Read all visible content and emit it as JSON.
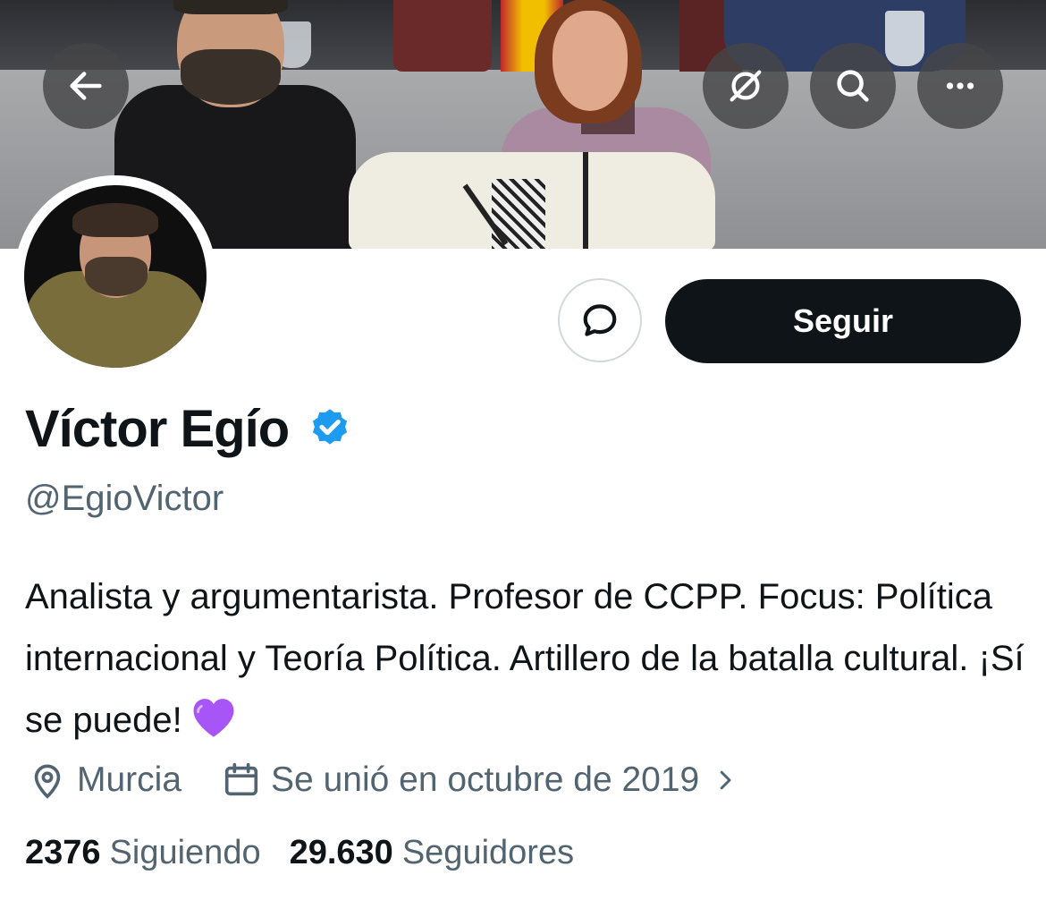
{
  "banner": {
    "back_icon": "arrow-left-icon",
    "top_actions": [
      "translate-off-icon",
      "search-icon",
      "more-icon"
    ]
  },
  "profile": {
    "name": "Víctor Egío",
    "handle": "@EgioVictor",
    "verified": true,
    "verified_color": "#1d9bf0",
    "bio": "Analista y argumentarista. Profesor de CCPP. Focus: Política internacional y Teoría Política. Artillero de la batalla cultural. ¡Sí se puede!",
    "bio_emoji": "purple-heart",
    "location": "Murcia",
    "joined": "Se unió en octubre de 2019"
  },
  "actions": {
    "follow_label": "Seguir",
    "message_icon": "message-bubble-icon"
  },
  "stats": {
    "following_count": "2376",
    "following_label": "Siguiendo",
    "followers_count": "29.630",
    "followers_label": "Seguidores"
  },
  "colors": {
    "text_primary": "#0f1419",
    "text_secondary": "#536471",
    "follow_bg": "#0f1419",
    "border": "#cfd9de",
    "heart": "#a855f7"
  }
}
